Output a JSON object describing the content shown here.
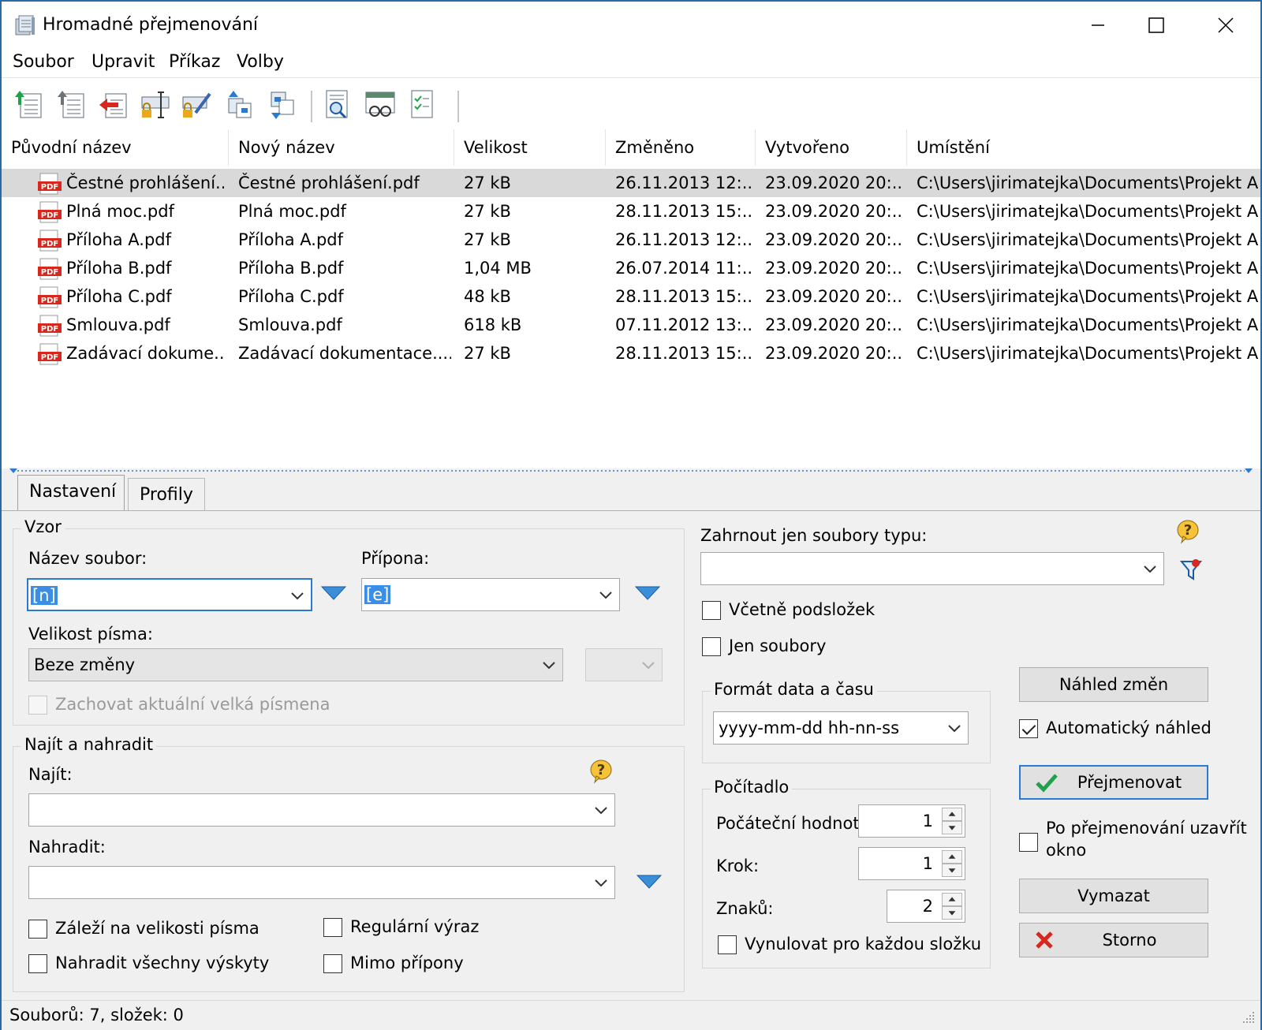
{
  "window": {
    "title": "Hromadné přejmenování"
  },
  "menu": [
    "Soubor",
    "Upravit",
    "Příkaz",
    "Volby"
  ],
  "toolbar_icons": [
    "add-files-icon",
    "add-folder-icon",
    "remove-icon",
    "rename-lock-icon",
    "rename-edit-lock-icon",
    "move-up-icon",
    "move-down-icon",
    "preview-file-icon",
    "view-icon",
    "checklist-icon"
  ],
  "list": {
    "headers": [
      "Původní název",
      "Nový název",
      "Velikost",
      "Změněno",
      "Vytvořeno",
      "Umístění"
    ],
    "rows": [
      [
        "Čestné prohlášení...",
        "Čestné prohlášení.pdf",
        "27 kB",
        "26.11.2013 12:...",
        "23.09.2020 20:...",
        "C:\\Users\\jirimatejka\\Documents\\Projekt A"
      ],
      [
        "Plná moc.pdf",
        "Plná moc.pdf",
        "27 kB",
        "28.11.2013 15:...",
        "23.09.2020 20:...",
        "C:\\Users\\jirimatejka\\Documents\\Projekt A"
      ],
      [
        "Příloha A.pdf",
        "Příloha A.pdf",
        "27 kB",
        "26.11.2013 12:...",
        "23.09.2020 20:...",
        "C:\\Users\\jirimatejka\\Documents\\Projekt A"
      ],
      [
        "Příloha B.pdf",
        "Příloha B.pdf",
        "1,04 MB",
        "26.07.2014 11:...",
        "23.09.2020 20:...",
        "C:\\Users\\jirimatejka\\Documents\\Projekt A"
      ],
      [
        "Příloha C.pdf",
        "Příloha C.pdf",
        "48 kB",
        "28.11.2013 15:...",
        "23.09.2020 20:...",
        "C:\\Users\\jirimatejka\\Documents\\Projekt A"
      ],
      [
        "Smlouva.pdf",
        "Smlouva.pdf",
        "618 kB",
        "07.11.2012 13:...",
        "23.09.2020 20:...",
        "C:\\Users\\jirimatejka\\Documents\\Projekt A"
      ],
      [
        "Zadávací dokume...",
        "Zadávací dokumentace....",
        "27 kB",
        "28.11.2013 15:...",
        "23.09.2020 20:...",
        "C:\\Users\\jirimatejka\\Documents\\Projekt A"
      ]
    ],
    "file_icon_text": "PDF"
  },
  "tabs": [
    "Nastavení",
    "Profily"
  ],
  "pattern": {
    "title": "Vzor",
    "name_label": "Název soubor:",
    "name_value": "[n]",
    "ext_label": "Přípona:",
    "ext_value": "[e]",
    "case_label": "Velikost písma:",
    "case_value": "Beze změny",
    "keep_upper": "Zachovat aktuální velká písmena"
  },
  "find_replace": {
    "title": "Najít a nahradit",
    "find_label": "Najít:",
    "find_value": "",
    "replace_label": "Nahradit:",
    "replace_value": "",
    "case_sensitive": "Záleží na velikosti písma",
    "regex": "Regulární výraz",
    "replace_all": "Nahradit všechny výskyty",
    "skip_ext": "Mimo přípony"
  },
  "filter": {
    "label": "Zahrnout jen soubory typu:",
    "value": "",
    "include_subfolders": "Včetně podsložek",
    "files_only": "Jen soubory"
  },
  "datetime": {
    "title": "Formát data a času",
    "value": "yyyy-mm-dd hh-nn-ss"
  },
  "counter": {
    "title": "Počítadlo",
    "start_label": "Počáteční hodnota",
    "start_value": "1",
    "step_label": "Krok:",
    "step_value": "1",
    "digits_label": "Znaků:",
    "digits_value": "2",
    "reset_per_folder": "Vynulovat pro každou složku"
  },
  "actions": {
    "preview": "Náhled změn",
    "auto_preview": "Automatický náhled",
    "auto_preview_checked": true,
    "rename": "Přejmenovat",
    "close_after_line1": "Po přejmenování uzavřít",
    "close_after_line2": "okno",
    "clear": "Vymazat",
    "cancel": "Storno"
  },
  "status": "Souborů: 7, složek: 0",
  "colors": {
    "accent": "#2a7ad2",
    "selection": "#d9d9d9",
    "pdf_red": "#d8271c"
  }
}
